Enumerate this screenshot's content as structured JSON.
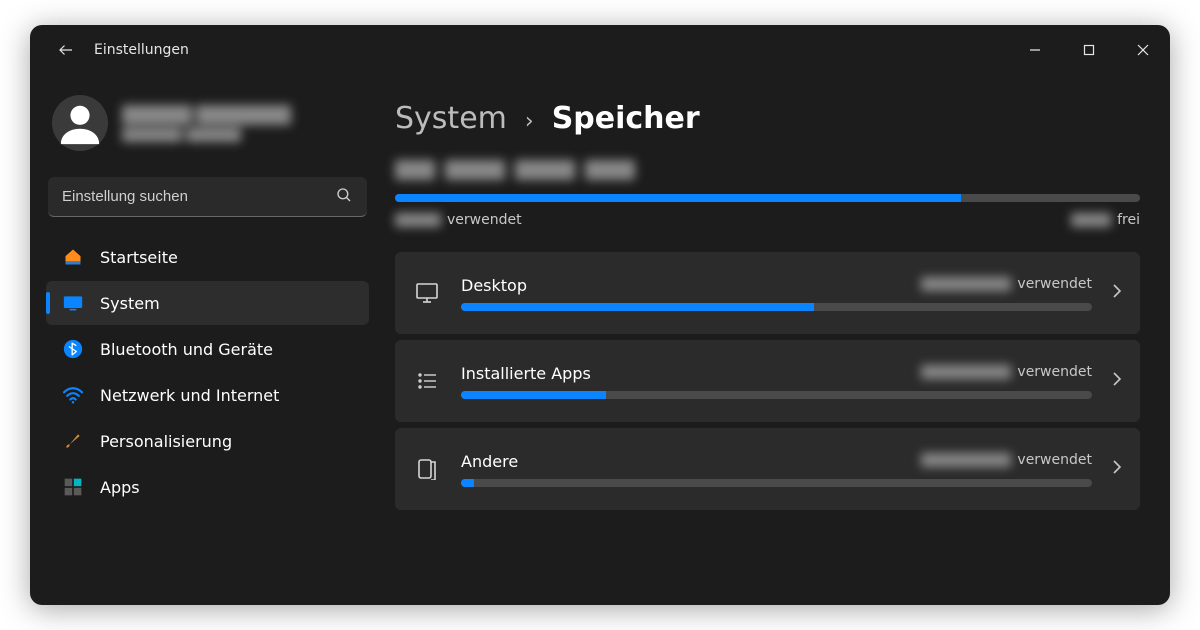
{
  "app_title": "Einstellungen",
  "search": {
    "placeholder": "Einstellung suchen"
  },
  "sidebar": {
    "items": [
      {
        "label": "Startseite"
      },
      {
        "label": "System"
      },
      {
        "label": "Bluetooth und Geräte"
      },
      {
        "label": "Netzwerk und Internet"
      },
      {
        "label": "Personalisierung"
      },
      {
        "label": "Apps"
      }
    ],
    "active_index": 1
  },
  "breadcrumb": {
    "parent": "System",
    "current": "Speicher"
  },
  "storage": {
    "overall": {
      "fill_pct": 76,
      "used_word": "verwendet",
      "free_word": "frei"
    },
    "categories": [
      {
        "name": "Desktop",
        "used_word": "verwendet",
        "fill_pct": 56,
        "icon": "desktop-icon"
      },
      {
        "name": "Installierte Apps",
        "used_word": "verwendet",
        "fill_pct": 23,
        "icon": "apps-icon"
      },
      {
        "name": "Andere",
        "used_word": "verwendet",
        "fill_pct": 2,
        "icon": "other-icon"
      }
    ]
  }
}
